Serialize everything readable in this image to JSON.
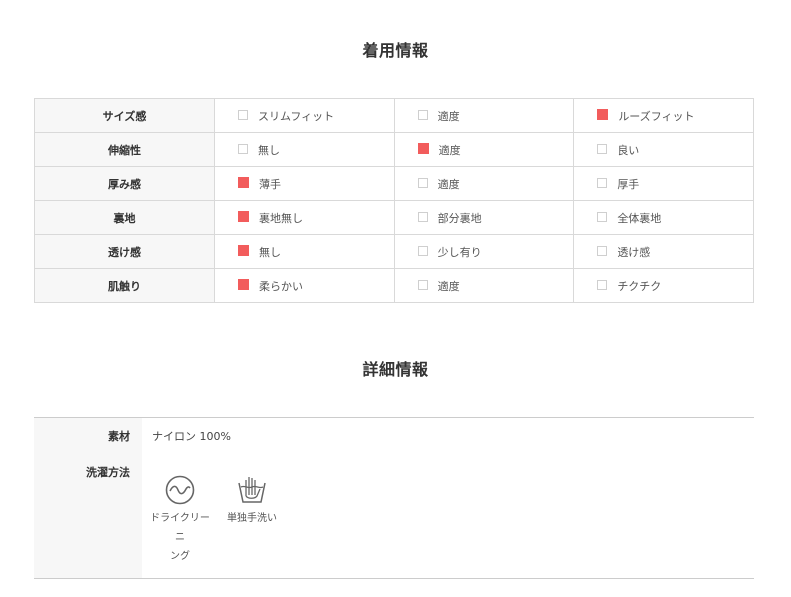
{
  "fit_info": {
    "title": "着用情報",
    "rows": [
      {
        "label": "サイズ感",
        "options": [
          {
            "label": "スリムフィット",
            "selected": false
          },
          {
            "label": "適度",
            "selected": false
          },
          {
            "label": "ルーズフィット",
            "selected": true
          }
        ]
      },
      {
        "label": "伸縮性",
        "options": [
          {
            "label": "無し",
            "selected": false
          },
          {
            "label": "適度",
            "selected": true
          },
          {
            "label": "良い",
            "selected": false
          }
        ]
      },
      {
        "label": "厚み感",
        "options": [
          {
            "label": "薄手",
            "selected": true
          },
          {
            "label": "適度",
            "selected": false
          },
          {
            "label": "厚手",
            "selected": false
          }
        ]
      },
      {
        "label": "裏地",
        "options": [
          {
            "label": "裏地無し",
            "selected": true
          },
          {
            "label": "部分裏地",
            "selected": false
          },
          {
            "label": "全体裏地",
            "selected": false
          }
        ]
      },
      {
        "label": "透け感",
        "options": [
          {
            "label": "無し",
            "selected": true
          },
          {
            "label": "少し有り",
            "selected": false
          },
          {
            "label": "透け感",
            "selected": false
          }
        ]
      },
      {
        "label": "肌触り",
        "options": [
          {
            "label": "柔らかい",
            "selected": true
          },
          {
            "label": "適度",
            "selected": false
          },
          {
            "label": "チクチク",
            "selected": false
          }
        ]
      }
    ],
    "selected_color": "#f25c5c"
  },
  "details": {
    "title": "詳細情報",
    "material_label": "素材",
    "material_value": "ナイロン 100%",
    "wash_label": "洗濯方法",
    "care": [
      {
        "icon": "dry-cleaning-icon",
        "label_line1": "ドライクリーニ",
        "label_line2": "ング"
      },
      {
        "icon": "hand-wash-icon",
        "label_line1": "単独手洗い"
      }
    ]
  }
}
